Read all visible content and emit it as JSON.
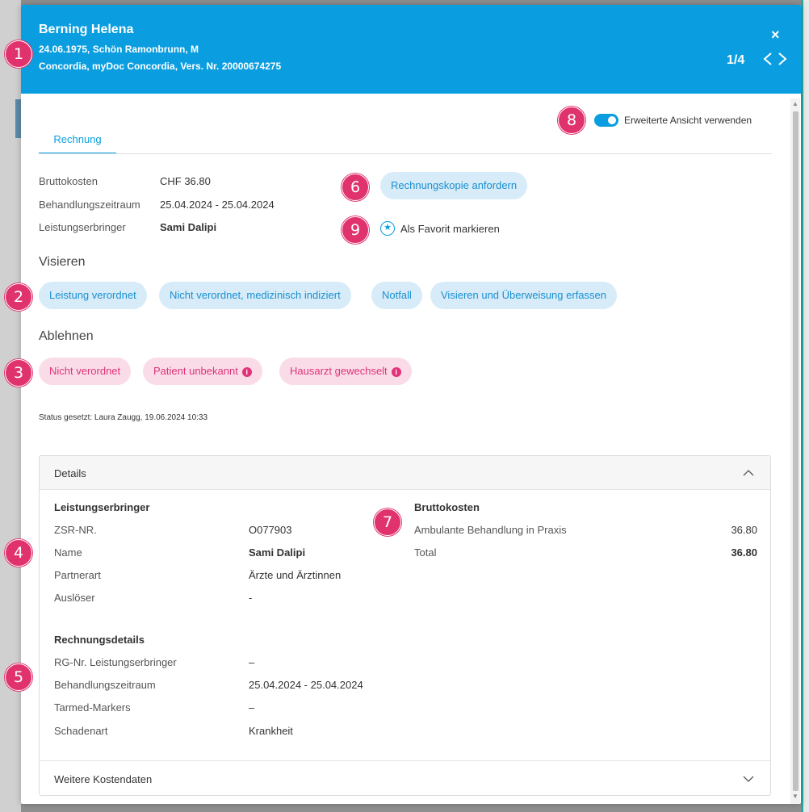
{
  "header": {
    "name": "Berning Helena",
    "line1": "24.06.1975, Schön Ramonbrunn, M",
    "line2": "Concordia, myDoc Concordia, Vers. Nr. 20000674275",
    "close_icon": "×",
    "pager": "1/4",
    "prev_icon": "chevron-left-icon",
    "next_icon": "chevron-right-icon"
  },
  "toggle": {
    "label": "Erweiterte Ansicht verwenden",
    "on": true
  },
  "tabs": [
    {
      "label": "Rechnung",
      "active": true
    }
  ],
  "summary": [
    {
      "key": "Bruttokosten",
      "value": "CHF 36.80"
    },
    {
      "key": "Behandlungszeitraum",
      "value": "25.04.2024 - 25.04.2024"
    },
    {
      "key": "Leistungserbringer",
      "value": "Sami Dalipi"
    }
  ],
  "actions": {
    "copy_button": "Rechnungskopie anfordern",
    "favorite_label": "Als Favorit markieren",
    "favorite_icon": "★"
  },
  "visieren": {
    "heading": "Visieren",
    "buttons": [
      "Leistung verordnet",
      "Nicht verordnet, medizinisch indiziert",
      "Notfall",
      "Visieren und Überweisung erfassen"
    ]
  },
  "ablehnen": {
    "heading": "Ablehnen",
    "buttons": [
      "Nicht verordnet",
      "Patient unbekannt",
      "Hausarzt gewechselt"
    ],
    "info_icon": "i"
  },
  "status": "Status gesetzt: Laura Zaugg, 19.06.2024 10:33",
  "details": {
    "title": "Details",
    "provider_heading": "Leistungserbringer",
    "provider": [
      {
        "key": "ZSR-NR.",
        "value": "O077903"
      },
      {
        "key": "Name",
        "value": "Sami Dalipi"
      },
      {
        "key": "Partnerart",
        "value": "Ärzte und Ärztinnen"
      },
      {
        "key": "Auslöser",
        "value": "-"
      }
    ],
    "invoice_heading": "Rechnungsdetails",
    "invoice": [
      {
        "key": "RG-Nr. Leistungserbringer",
        "value": "–"
      },
      {
        "key": "Behandlungszeitraum",
        "value": "25.04.2024 - 25.04.2024"
      },
      {
        "key": "Tarmed-Markers",
        "value": "–"
      },
      {
        "key": "Schadenart",
        "value": "Krankheit"
      }
    ],
    "costs_heading": "Bruttokosten",
    "costs": [
      {
        "key": "Ambulante Behandlung in Praxis",
        "value": "36.80"
      },
      {
        "key": "Total",
        "value": "36.80"
      }
    ],
    "more_label": "Weitere Kostendaten"
  },
  "markers": [
    "1",
    "2",
    "3",
    "4",
    "5",
    "6",
    "7",
    "8",
    "9"
  ],
  "colors": {
    "accent": "#0a9ee0",
    "reject": "#e0337a",
    "marker": "#e0336e"
  }
}
